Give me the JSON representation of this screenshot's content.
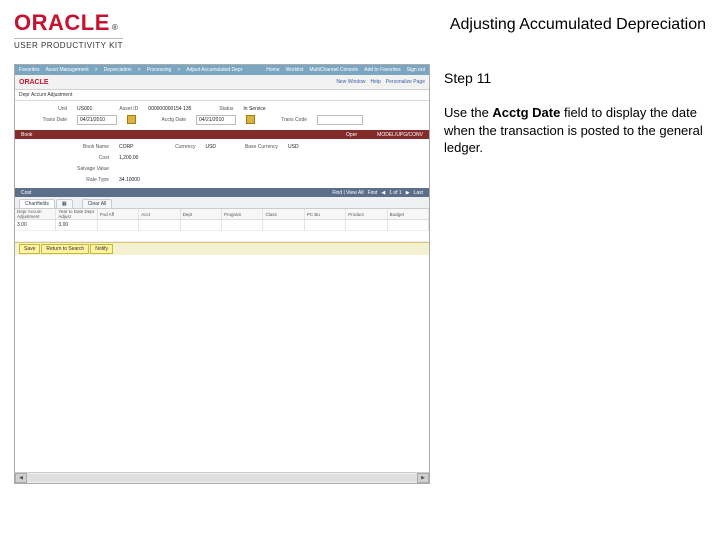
{
  "header": {
    "brand": "ORACLE",
    "tm": "®",
    "product_line": "USER PRODUCTIVITY KIT",
    "lesson_title": "Adjusting Accumulated Depreciation"
  },
  "step": {
    "heading": "Step 11",
    "body_pre": "Use the ",
    "body_field": "Acctg Date",
    "body_post": " field to display the date when the transaction is posted to the general ledger."
  },
  "mini": {
    "topnav": [
      "Favorites",
      "Asset Management",
      "Depreciation",
      "Processing",
      "Adjust Accumulated Depr"
    ],
    "toplinks": [
      "Home",
      "Worklist",
      "MultiChannel Console",
      "Add to Favorites",
      "Sign out"
    ],
    "rightlinks": [
      "New Window",
      "Help",
      "Personalize Page"
    ],
    "page_title": "Depr Accum Adjustment",
    "row1": {
      "unit_label": "Unit",
      "unit_value": "US001",
      "assetid_label": "Asset ID",
      "assetid_value": "000000000154  135",
      "status_label": "Status",
      "status_value": "In Service"
    },
    "row2": {
      "transdate_label": "Trans Date",
      "transdate_value": "04/21/2010",
      "acctg_label": "Acctg Date",
      "acctg_value": "04/21/2010",
      "transcode_label": "Trans Code"
    },
    "band": {
      "left": "Book",
      "right_label": "Oper",
      "right_value": "MODEL/UPG/CONV"
    },
    "sub": {
      "bookname_label": "Book Name",
      "bookname_value": "CORP",
      "currency_label": "Currency",
      "currency_value": "USD",
      "basecurrency_label": "Base Currency",
      "basecurrency_value": "USD",
      "cost_label": "Cost",
      "cost_value": "1,200.00",
      "salvage_label": "Salvage Value",
      "rate_label": "Rate Type",
      "rate_value": "34.10000"
    },
    "costband": {
      "label": "Cost",
      "find": "Find | View All",
      "nav": "First",
      "pos": "1 of 1",
      "last": "Last"
    },
    "tabs": [
      "Chartfields"
    ],
    "clearall": "Clear All",
    "gridcols": [
      "Depr Accum Adjustment",
      "Year to Date Depr Adjust",
      "Fnd Aff",
      "Acct",
      "Dept",
      "Program",
      "Class",
      "PC Bu",
      "Product",
      "Budget"
    ],
    "gridvals": [
      "3.00",
      "3.00",
      "",
      "",
      "",
      "",
      "",
      "",
      "",
      ""
    ],
    "footer": {
      "save": "Save",
      "return": "Return to Search",
      "notify": "Notify"
    }
  }
}
